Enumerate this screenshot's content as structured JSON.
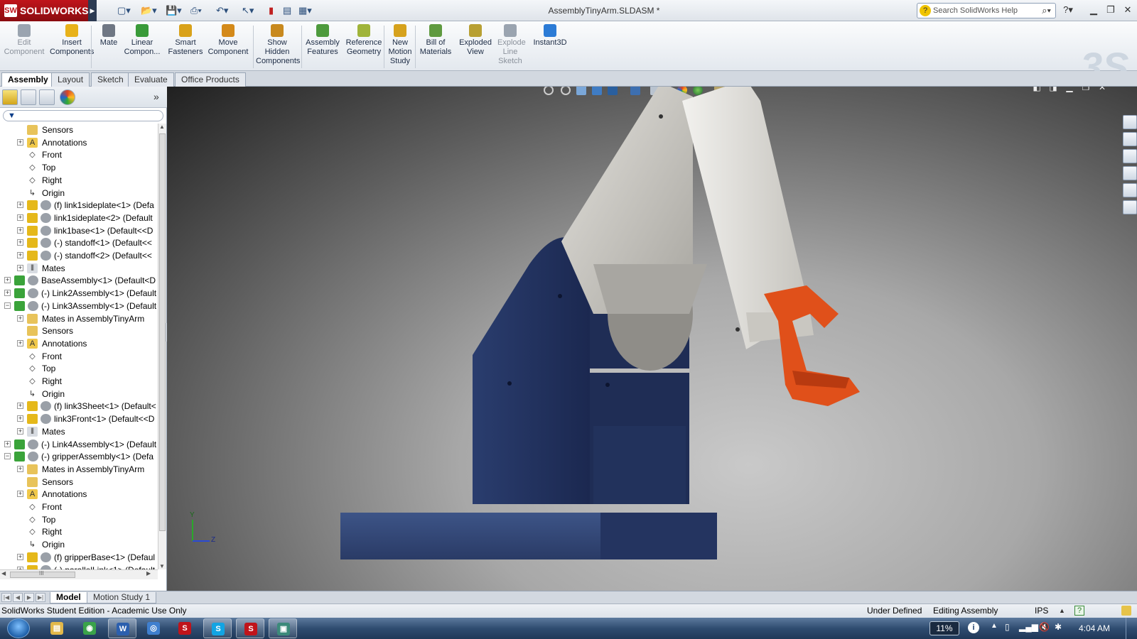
{
  "app": {
    "brand": "SOLIDWORKS",
    "document_title": "AssemblyTinyArm.SLDASM *",
    "search_placeholder": "Search SolidWorks Help"
  },
  "commands": [
    {
      "label": "Edit\nComponent",
      "icon": "edit-component-icon",
      "disabled": true,
      "color": "#9aa4b0"
    },
    {
      "label": "Insert\nComponents",
      "icon": "insert-components-icon",
      "disabled": false,
      "color": "#e8b21a"
    },
    {
      "label": "Mate",
      "icon": "mate-icon",
      "disabled": false,
      "color": "#6f7784"
    },
    {
      "label": "Linear\nCompon...",
      "icon": "linear-pattern-icon",
      "disabled": false,
      "color": "#3a9b3a"
    },
    {
      "label": "Smart\nFasteners",
      "icon": "smart-fasteners-icon",
      "disabled": false,
      "color": "#d9a21a"
    },
    {
      "label": "Move\nComponent",
      "icon": "move-component-icon",
      "disabled": false,
      "color": "#d48a1a"
    },
    {
      "label": "Show\nHidden\nComponents",
      "icon": "show-hidden-icon",
      "disabled": false,
      "color": "#c8891e"
    },
    {
      "label": "Assembly\nFeatures",
      "icon": "assembly-features-icon",
      "disabled": false,
      "color": "#4d9a3d"
    },
    {
      "label": "Reference\nGeometry",
      "icon": "reference-geometry-icon",
      "disabled": false,
      "color": "#a0b43a"
    },
    {
      "label": "New\nMotion\nStudy",
      "icon": "motion-study-icon",
      "disabled": false,
      "color": "#d6a21d"
    },
    {
      "label": "Bill of\nMaterials",
      "icon": "bill-of-materials-icon",
      "disabled": false,
      "color": "#5f9a3f"
    },
    {
      "label": "Exploded\nView",
      "icon": "exploded-view-icon",
      "disabled": false,
      "color": "#b8a033"
    },
    {
      "label": "Explode\nLine\nSketch",
      "icon": "explode-line-sketch-icon",
      "disabled": true,
      "color": "#9aa4b0"
    },
    {
      "label": "Instant3D",
      "icon": "instant3d-icon",
      "disabled": false,
      "color": "#2b7bd6"
    }
  ],
  "tabs": [
    "Assembly",
    "Layout",
    "Sketch",
    "Evaluate",
    "Office Products"
  ],
  "filter_symbol": "▼",
  "tree": [
    {
      "label": "Sensors",
      "icon": "sensors-icon",
      "indent": 2,
      "expander": false
    },
    {
      "label": "Annotations",
      "icon": "annotations-icon",
      "indent": 2,
      "expander": true
    },
    {
      "label": "Front",
      "icon": "plane-icon",
      "indent": 2,
      "expander": false
    },
    {
      "label": "Top",
      "icon": "plane-icon",
      "indent": 2,
      "expander": false
    },
    {
      "label": "Right",
      "icon": "plane-icon",
      "indent": 2,
      "expander": false
    },
    {
      "label": "Origin",
      "icon": "origin-icon",
      "indent": 2,
      "expander": false
    },
    {
      "label": "(f) link1sideplate<1> (Defa",
      "icon": "part-icon",
      "indent": 2,
      "expander": true
    },
    {
      "label": "link1sideplate<2> (Default",
      "icon": "part-icon",
      "indent": 2,
      "expander": true
    },
    {
      "label": "link1base<1> (Default<<D",
      "icon": "part-icon",
      "indent": 2,
      "expander": true
    },
    {
      "label": "(-) standoff<1> (Default<<",
      "icon": "part-icon",
      "indent": 2,
      "expander": true
    },
    {
      "label": "(-) standoff<2> (Default<<",
      "icon": "part-icon",
      "indent": 2,
      "expander": true
    },
    {
      "label": "Mates",
      "icon": "mates-icon",
      "indent": 2,
      "expander": true
    },
    {
      "label": "BaseAssembly<1> (Default<D",
      "icon": "assembly-icon",
      "indent": 1,
      "expander": true
    },
    {
      "label": "(-) Link2Assembly<1> (Default",
      "icon": "assembly-icon",
      "indent": 1,
      "expander": true
    },
    {
      "label": "(-) Link3Assembly<1> (Default",
      "icon": "assembly-icon",
      "indent": 1,
      "expander": true,
      "expanded": true
    },
    {
      "label": "Mates in AssemblyTinyArm",
      "icon": "mates-folder-icon",
      "indent": 2,
      "expander": true
    },
    {
      "label": "Sensors",
      "icon": "sensors-icon",
      "indent": 2,
      "expander": false
    },
    {
      "label": "Annotations",
      "icon": "annotations-icon",
      "indent": 2,
      "expander": true
    },
    {
      "label": "Front",
      "icon": "plane-icon",
      "indent": 2,
      "expander": false
    },
    {
      "label": "Top",
      "icon": "plane-icon",
      "indent": 2,
      "expander": false
    },
    {
      "label": "Right",
      "icon": "plane-icon",
      "indent": 2,
      "expander": false
    },
    {
      "label": "Origin",
      "icon": "origin-icon",
      "indent": 2,
      "expander": false
    },
    {
      "label": "(f) link3Sheet<1> (Default<",
      "icon": "part-icon",
      "indent": 2,
      "expander": true
    },
    {
      "label": "link3Front<1> (Default<<D",
      "icon": "part-icon",
      "indent": 2,
      "expander": true
    },
    {
      "label": "Mates",
      "icon": "mates-icon",
      "indent": 2,
      "expander": true
    },
    {
      "label": "(-) Link4Assembly<1> (Default",
      "icon": "assembly-icon",
      "indent": 1,
      "expander": true
    },
    {
      "label": "(-) gripperAssembly<1> (Defa",
      "icon": "assembly-icon",
      "indent": 1,
      "expander": true,
      "expanded": true
    },
    {
      "label": "Mates in AssemblyTinyArm",
      "icon": "mates-folder-icon",
      "indent": 2,
      "expander": true
    },
    {
      "label": "Sensors",
      "icon": "sensors-icon",
      "indent": 2,
      "expander": false
    },
    {
      "label": "Annotations",
      "icon": "annotations-icon",
      "indent": 2,
      "expander": true
    },
    {
      "label": "Front",
      "icon": "plane-icon",
      "indent": 2,
      "expander": false
    },
    {
      "label": "Top",
      "icon": "plane-icon",
      "indent": 2,
      "expander": false
    },
    {
      "label": "Right",
      "icon": "plane-icon",
      "indent": 2,
      "expander": false
    },
    {
      "label": "Origin",
      "icon": "origin-icon",
      "indent": 2,
      "expander": false
    },
    {
      "label": "(f) gripperBase<1> (Defaul",
      "icon": "part-icon",
      "indent": 2,
      "expander": true
    },
    {
      "label": "(-) parallelLink<1> (Default",
      "icon": "part-icon",
      "indent": 2,
      "expander": true
    }
  ],
  "hscroll_grip": "III",
  "triad": {
    "y": "Y",
    "z": "Z"
  },
  "bottom_tabs": [
    "Model",
    "Motion Study 1"
  ],
  "status": {
    "left": "SolidWorks Student Edition - Academic Use Only",
    "under_defined": "Under Defined",
    "editing": "Editing Assembly",
    "units": "IPS",
    "help": "?"
  },
  "taskbar": {
    "apps": [
      {
        "name": "file-explorer",
        "glyph": "▤",
        "color": "#e2b84a",
        "running": false
      },
      {
        "name": "chrome",
        "glyph": "◉",
        "color": "#3aa34a",
        "running": false
      },
      {
        "name": "word",
        "glyph": "W",
        "color": "#2b5fae",
        "running": true
      },
      {
        "name": "media",
        "glyph": "◎",
        "color": "#3f7fcf",
        "running": false
      },
      {
        "name": "solidworks-launcher",
        "glyph": "S",
        "color": "#c0141b",
        "running": false
      },
      {
        "name": "skype",
        "glyph": "S",
        "color": "#12a4e3",
        "running": true
      },
      {
        "name": "solidworks",
        "glyph": "S",
        "color": "#c0141b",
        "running": true
      },
      {
        "name": "solidworks-utility",
        "glyph": "▣",
        "color": "#3c8a7a",
        "running": true
      }
    ],
    "battery": "11%",
    "clock": "4:04 AM"
  },
  "colors": {
    "base_blue": "#1f2f55",
    "link_silver": "#d8d6d0",
    "gripper_orange": "#e0501a"
  }
}
